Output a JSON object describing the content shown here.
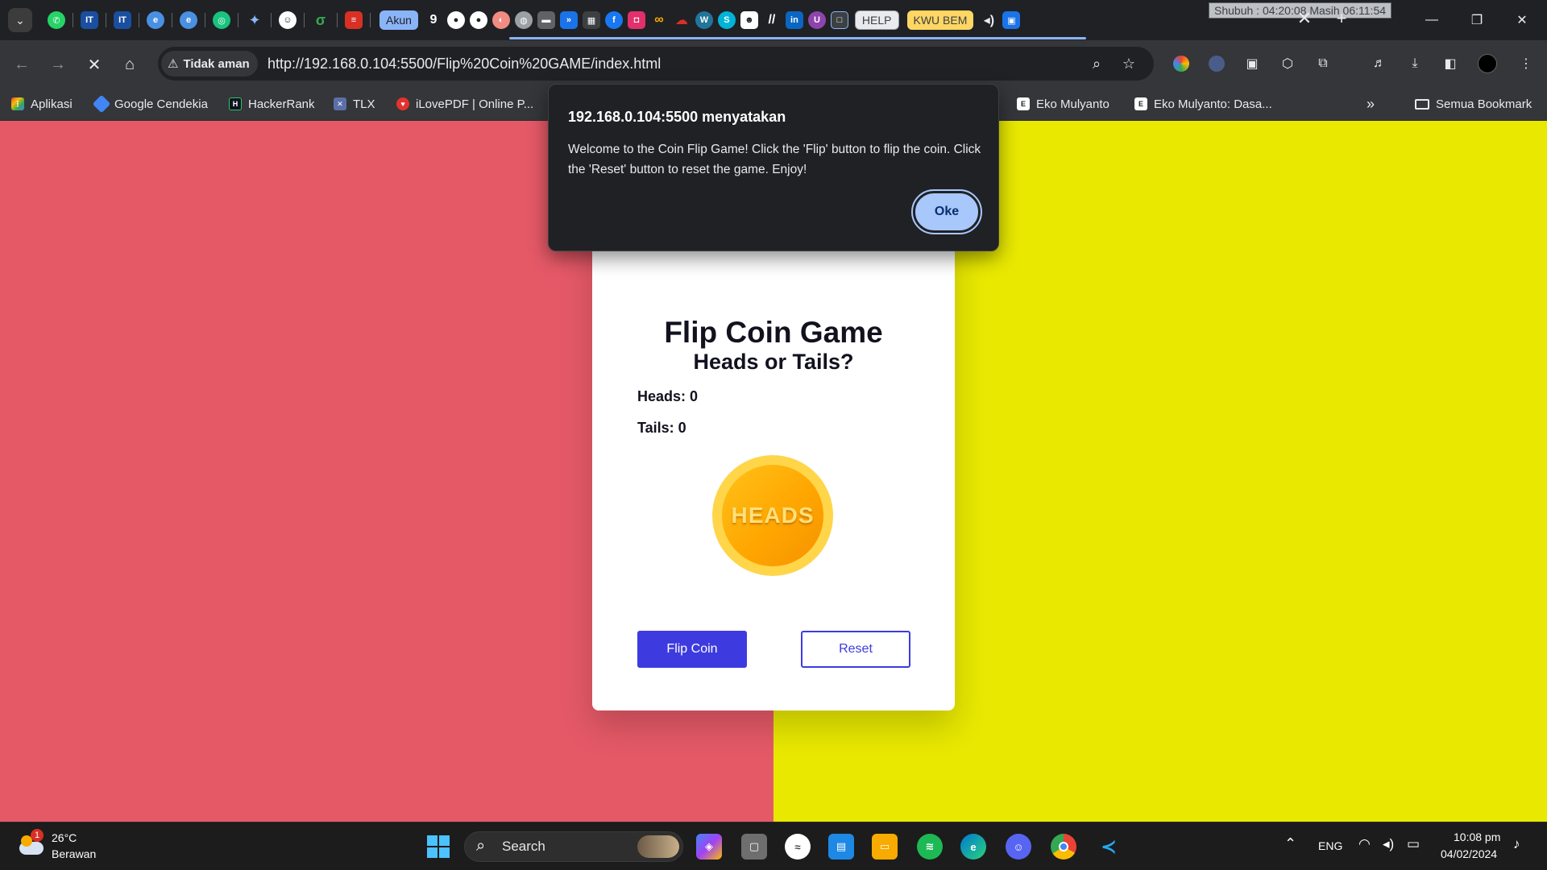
{
  "browser": {
    "tabs": {
      "pill_akun": "Akun",
      "pill_help": "HELP",
      "pill_kwu": "KWU BEM",
      "prayer_widget": "Shubuh : 04:20:08  Masih 06:11:54"
    },
    "security_label": "Tidak aman",
    "url": "http://192.168.0.104:5500/Flip%20Coin%20GAME/index.html",
    "bookmarks": {
      "apps": "Aplikasi",
      "google_scholar": "Google Cendekia",
      "hackerrank": "HackerRank",
      "tlx": "TLX",
      "ilovepdf": "iLovePDF | Online P...",
      "eko_1": "Eko Mulyanto",
      "eko_2": "Eko Mulyanto: Dasa...",
      "all_bookmarks": "Semua Bookmark"
    }
  },
  "dialog": {
    "title": "192.168.0.104:5500 menyatakan",
    "message": "Welcome to the Coin Flip Game! Click the 'Flip' button to flip the coin. Click the 'Reset' button to reset the game. Enjoy!",
    "ok_label": "Oke"
  },
  "game": {
    "title": "Flip Coin Game",
    "subtitle": "Heads or Tails?",
    "heads_label": "Heads: 0",
    "tails_label": "Tails: 0",
    "coin_face": "HEADS",
    "flip_label": "Flip Coin",
    "reset_label": "Reset",
    "colors": {
      "left_bg": "#e55967",
      "right_bg": "#e8e800",
      "button": "#3d3bdf",
      "coin": "#ffa600"
    }
  },
  "taskbar": {
    "weather_temp": "26°C",
    "weather_desc": "Berawan",
    "weather_badge": "1",
    "search_label": "Search",
    "language": "ENG",
    "time": "10:08 pm",
    "date": "04/02/2024"
  }
}
